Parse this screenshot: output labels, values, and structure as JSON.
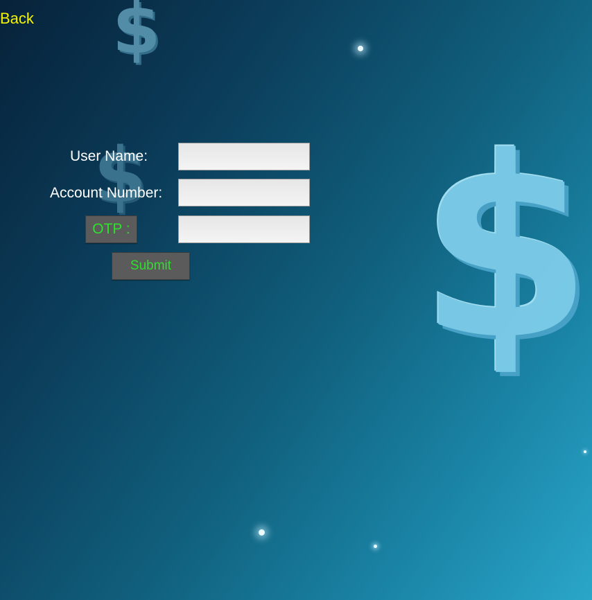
{
  "nav": {
    "back_label": "Back"
  },
  "form": {
    "user_name_label": "User Name:",
    "user_name_value": "",
    "account_number_label": "Account Number:",
    "account_number_value": "",
    "otp_button_label": "OTP :",
    "otp_value": "",
    "submit_label": "Submit"
  },
  "background": {
    "decorations": [
      "dollar-sign-icon",
      "dollar-sign-icon",
      "dollar-sign-icon",
      "sparkle-icon"
    ],
    "dollar_glyph": "$"
  },
  "colors": {
    "back_link": "#f4f400",
    "button_text": "#2fe02f",
    "button_bg": "#5b5b5b",
    "label_text": "#ffffff",
    "background_dark": "#07223a",
    "background_light": "#2aa6c9",
    "dollar_accent": "#7ecdea"
  }
}
